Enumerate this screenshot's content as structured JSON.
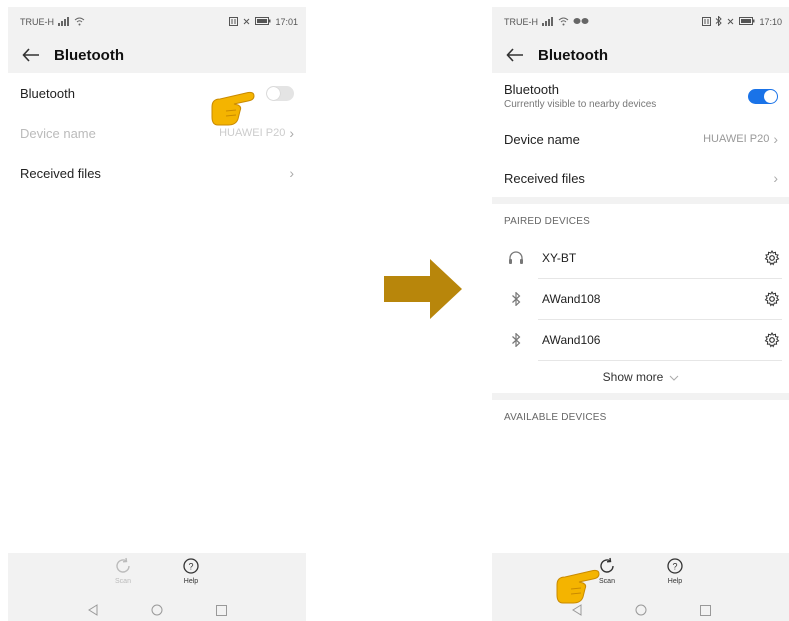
{
  "left": {
    "status": {
      "carrier": "TRUE-H",
      "time": "17:01"
    },
    "header": {
      "title": "Bluetooth"
    },
    "rows": {
      "bluetooth_label": "Bluetooth",
      "device_name_label": "Device name",
      "device_name_value": "HUAWEI P20",
      "received_files_label": "Received files"
    },
    "bottom": {
      "scan_label": "Scan",
      "help_label": "Help"
    }
  },
  "right": {
    "status": {
      "carrier": "TRUE-H",
      "time": "17:10"
    },
    "header": {
      "title": "Bluetooth"
    },
    "rows": {
      "bluetooth_label": "Bluetooth",
      "bluetooth_sub": "Currently visible to nearby devices",
      "device_name_label": "Device name",
      "device_name_value": "HUAWEI P20",
      "received_files_label": "Received files"
    },
    "paired_header": "PAIRED DEVICES",
    "paired_devices": [
      {
        "name": "XY-BT",
        "icon": "headphones-icon"
      },
      {
        "name": "AWand108",
        "icon": "bluetooth-icon"
      },
      {
        "name": "AWand106",
        "icon": "bluetooth-icon"
      }
    ],
    "show_more": "Show more",
    "available_header": "AVAILABLE DEVICES",
    "bottom": {
      "scan_label": "Scan",
      "help_label": "Help"
    }
  },
  "colors": {
    "accent": "#1a73e8",
    "arrow": "#b8860b",
    "hand": "#f4b400"
  }
}
